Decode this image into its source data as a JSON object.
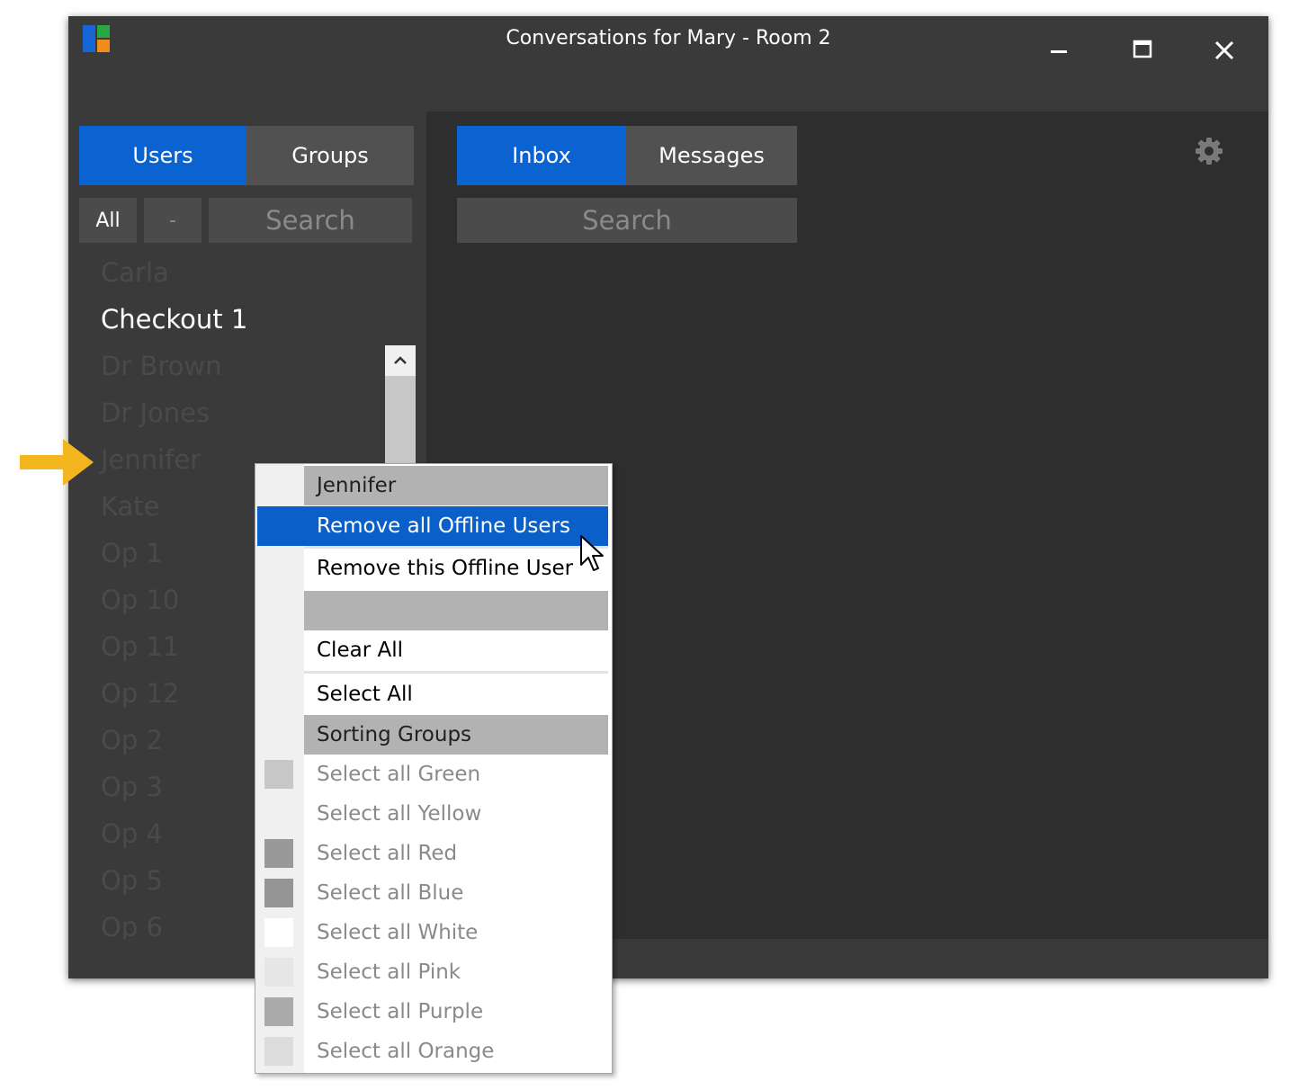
{
  "window": {
    "title": "Conversations for Mary - Room 2"
  },
  "left": {
    "tabs": [
      {
        "label": "Users",
        "active": true
      },
      {
        "label": "Groups",
        "active": false
      }
    ],
    "filters": {
      "all_label": "All",
      "dash_label": "-"
    },
    "search_placeholder": "Search",
    "users": [
      {
        "name": "Carla",
        "online": false
      },
      {
        "name": "Checkout 1",
        "online": true
      },
      {
        "name": "Dr Brown",
        "online": false
      },
      {
        "name": "Dr Jones",
        "online": false
      },
      {
        "name": "Jennifer",
        "online": false
      },
      {
        "name": "Kate",
        "online": false
      },
      {
        "name": "Op 1",
        "online": false
      },
      {
        "name": "Op 10",
        "online": false
      },
      {
        "name": "Op 11",
        "online": false
      },
      {
        "name": "Op 12",
        "online": false
      },
      {
        "name": "Op 2",
        "online": false
      },
      {
        "name": "Op 3",
        "online": false
      },
      {
        "name": "Op 4",
        "online": false
      },
      {
        "name": "Op 5",
        "online": false
      },
      {
        "name": "Op 6",
        "online": false
      }
    ]
  },
  "right": {
    "tabs": [
      {
        "label": "Inbox",
        "active": true
      },
      {
        "label": "Messages",
        "active": false
      }
    ],
    "search_placeholder": "Search"
  },
  "context_menu": {
    "header": "Jennifer",
    "items": {
      "remove_all_offline": "Remove all Offline Users",
      "remove_this_offline": "Remove this Offline User",
      "clear_all": "Clear All",
      "select_all": "Select All"
    },
    "sorting_header": "Sorting Groups",
    "sorting_items": [
      {
        "label": "Select all Green",
        "swatch": "#c7c7c7"
      },
      {
        "label": "Select all Yellow",
        "swatch": "#f0f0f0"
      },
      {
        "label": "Select all Red",
        "swatch": "#999999"
      },
      {
        "label": "Select all Blue",
        "swatch": "#959595"
      },
      {
        "label": "Select all White",
        "swatch": "#ffffff"
      },
      {
        "label": "Select all Pink",
        "swatch": "#e6e6e6"
      },
      {
        "label": "Select all Purple",
        "swatch": "#aaaaaa"
      },
      {
        "label": "Select all Orange",
        "swatch": "#dcdcdc"
      }
    ]
  },
  "colors": {
    "accent": "#0a63d0",
    "highlight": "#0a5fc8",
    "arrow": "#f3b61f"
  }
}
